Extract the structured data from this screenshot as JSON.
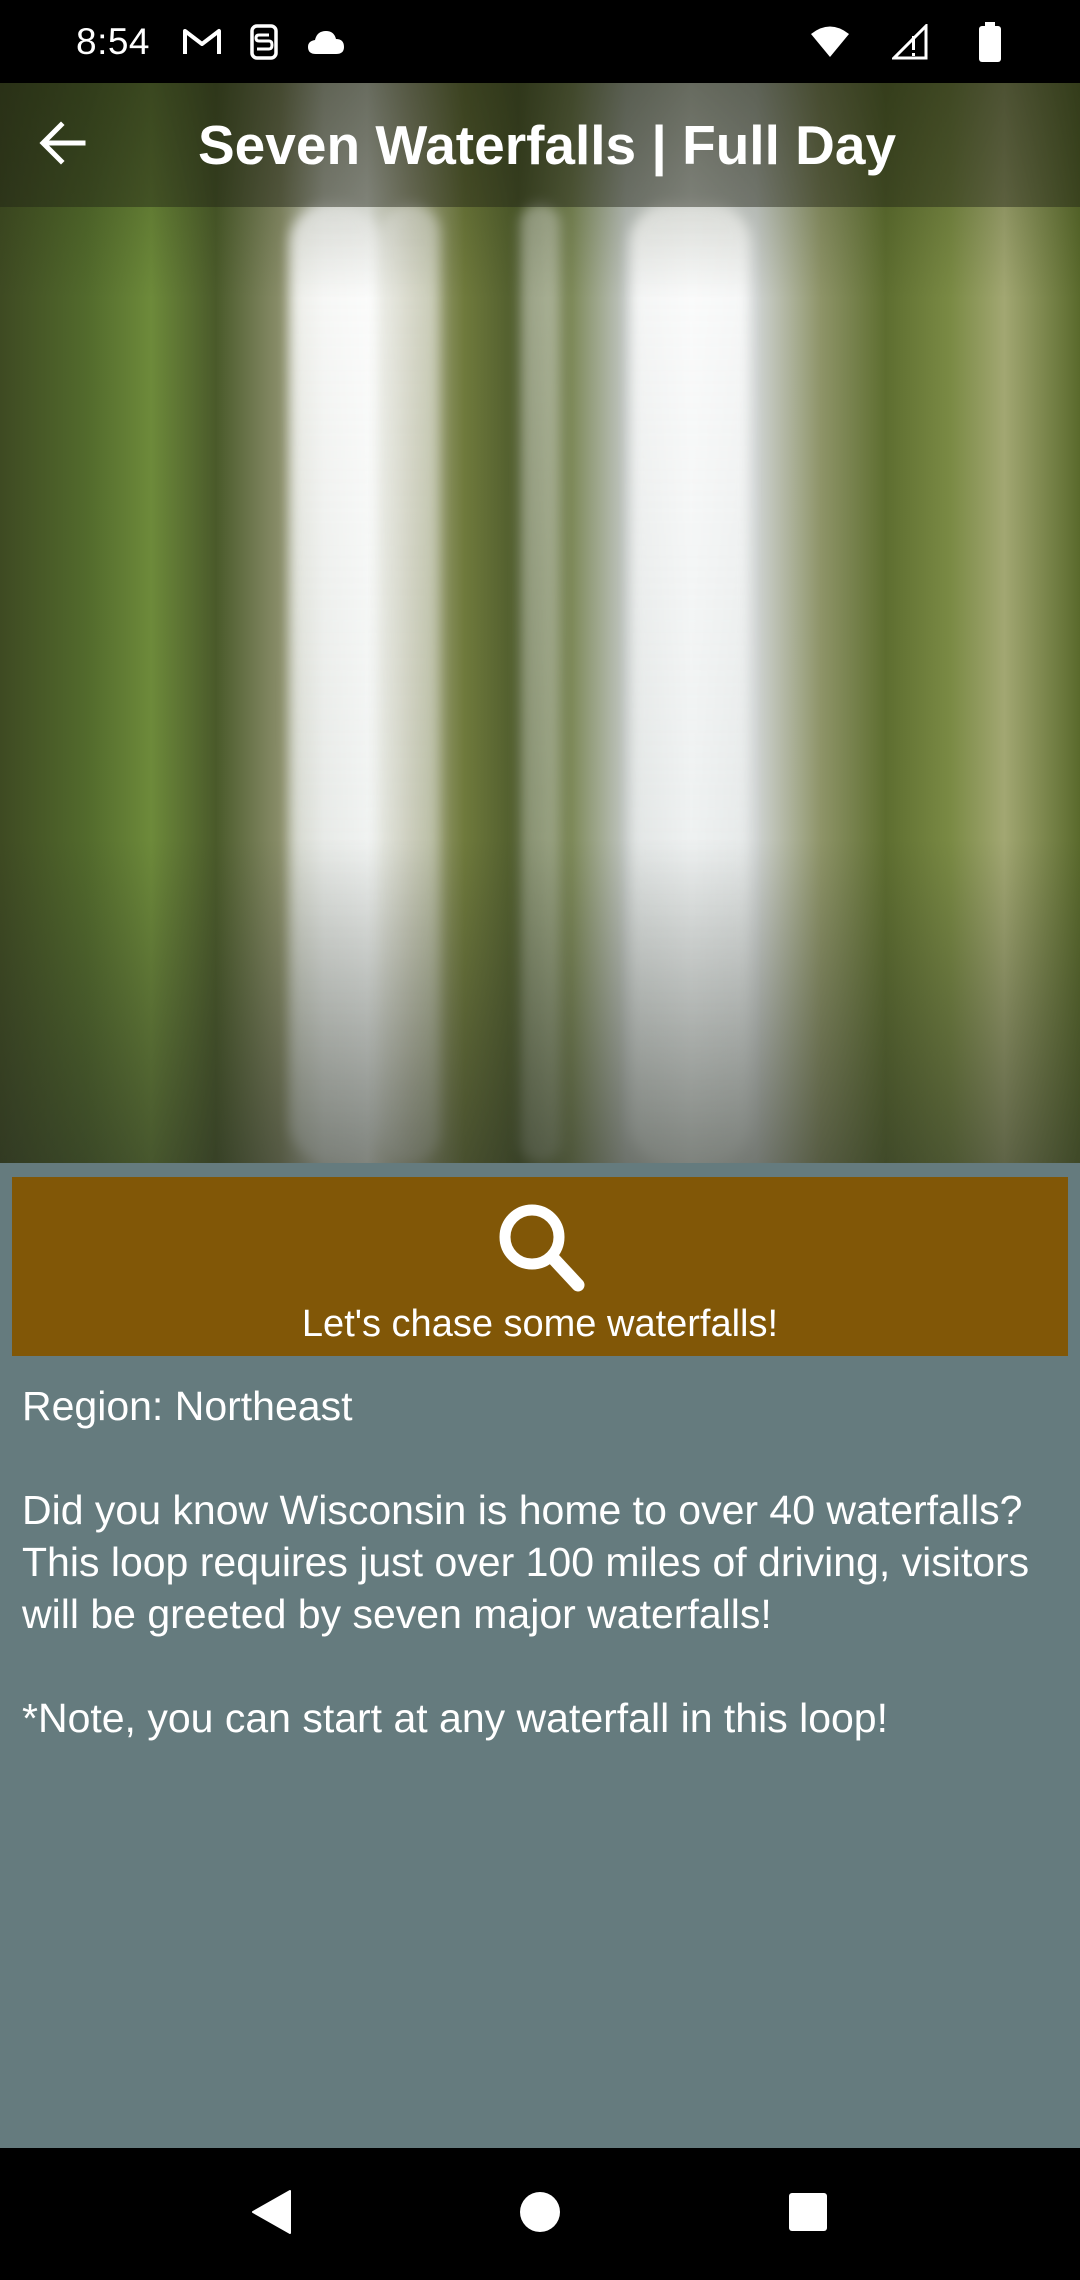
{
  "status_bar": {
    "time": "8:54",
    "icons": [
      "gmail-icon",
      "sync-icon",
      "cloud-icon"
    ],
    "right_icons": [
      "wifi-icon",
      "signal-icon",
      "battery-icon"
    ]
  },
  "app_bar": {
    "title": "Seven Waterfalls | Full Day",
    "back_icon": "arrow-back-icon"
  },
  "hero": {
    "image_subject": "waterfall"
  },
  "search_button": {
    "icon": "search-icon",
    "label": "Let's chase some waterfalls!",
    "color": "#815707"
  },
  "content": {
    "region": "Region: Northeast",
    "description": "Did you know Wisconsin is home to over 40 waterfalls? This loop requires just over 100 miles of driving, visitors will be greeted by seven major waterfalls!",
    "note": "*Note, you can start at any waterfall in this loop!"
  },
  "nav_bar": {
    "back": "nav-back-icon",
    "home": "nav-home-icon",
    "recents": "nav-recents-icon"
  },
  "colors": {
    "background": "#657b7e",
    "button": "#815707"
  }
}
